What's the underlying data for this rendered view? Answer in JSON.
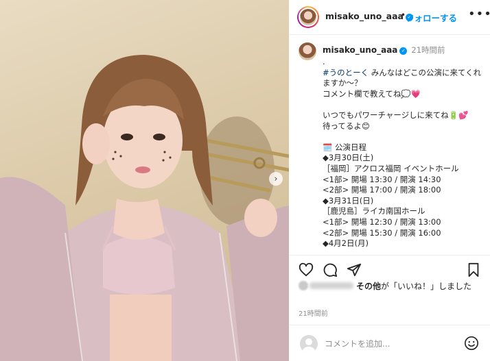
{
  "post": {
    "username": "misako_uno_aaa",
    "follow_label": "フォローする",
    "more_label": "•••",
    "carousel_next": "›"
  },
  "caption": {
    "username": "misako_uno_aaa",
    "time": "21時間前",
    "line0": ".",
    "hashtag": "#うのとーく",
    "line1": " みんなはどこの公演に来てくれますか〜？",
    "line2": "コメント欄で教えてね💭💗",
    "line3": "いつでもパワーチャージしに来てね🔋💕",
    "line4": "待ってるよ😊",
    "schedule_title": "🗓️ 公演日程",
    "date1": "◆3月30日(土)",
    "venue1": "［福岡］アクロス福岡 イベントホール",
    "part1a": "<1部> 開場 13:30 / 開演 14:30",
    "part1b": "<2部> 開場 17:00 / 開演 18:00",
    "date2": "◆3月31日(日)",
    "venue2": "［鹿児島］ライカ南国ホール",
    "part2a": "<1部> 開場 12:30 / 開演 13:00",
    "part2b": "<2部> 開場 15:30 / 開演 16:00",
    "date3": "◆4月2日(月)"
  },
  "likes": {
    "others": "その他",
    "suffix": "が「いいね！」しました"
  },
  "post_time": "21時間前",
  "comment": {
    "placeholder": "コメントを追加..."
  },
  "icons": [
    "heart-icon",
    "comment-icon",
    "share-icon",
    "bookmark-icon",
    "emoji-icon",
    "verified-icon"
  ],
  "colors": {
    "accent": "#0095f6",
    "hashtag": "#00376b",
    "muted": "#8e8e8e"
  }
}
